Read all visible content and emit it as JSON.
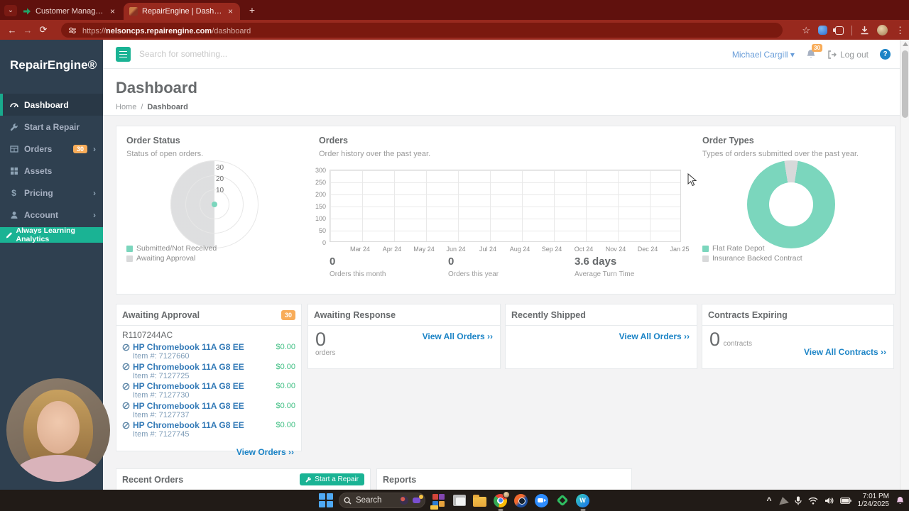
{
  "browser": {
    "tabs": [
      {
        "title": "Customer Manager | RepairEng"
      },
      {
        "title": "RepairEngine | Dashboard"
      }
    ],
    "url_scheme": "https://",
    "url_host": "nelsoncps.repairengine.com",
    "url_path": "/dashboard"
  },
  "glyphs": {
    "back": "←",
    "forward": "→",
    "refresh": "⟳",
    "star": "☆",
    "menu": "⋮",
    "new_tab": "+",
    "close": "×",
    "tab_search": "⌄",
    "chevron_right": "›",
    "caret_down": "▾",
    "help": "?",
    "tray_chevron": "^",
    "breadcrumb_sep": "/",
    "dollar": "$"
  },
  "sidebar": {
    "logo": "RepairEngine®",
    "items": [
      {
        "label": "Dashboard"
      },
      {
        "label": "Start a Repair"
      },
      {
        "label": "Orders",
        "badge": "30"
      },
      {
        "label": "Assets"
      },
      {
        "label": "Pricing"
      },
      {
        "label": "Account"
      }
    ],
    "analytics_button": "Always Learning Analytics"
  },
  "header": {
    "search_placeholder": "Search for something...",
    "user_name": "Michael Cargill",
    "notification_badge": "30",
    "logout_label": "Log out"
  },
  "page": {
    "title": "Dashboard",
    "breadcrumb_home": "Home",
    "breadcrumb_current": "Dashboard"
  },
  "chart_data": [
    {
      "type": "polar-area",
      "title": "Order Status",
      "subtitle": "Status of open orders.",
      "radial_ticks": [
        "30",
        "20",
        "10"
      ],
      "rlim": [
        0,
        30
      ],
      "series": [
        {
          "name": "Submitted/Not Received",
          "value": 2,
          "color": "#7bd6bd"
        },
        {
          "name": "Awaiting Approval",
          "value": 30,
          "color": "#d8d9da"
        }
      ],
      "legend_position": "bottom-left"
    },
    {
      "type": "line",
      "title": "Orders",
      "subtitle": "Order history over the past year.",
      "x": [
        "Mar 24",
        "Apr 24",
        "May 24",
        "Jun 24",
        "Jul 24",
        "Aug 24",
        "Sep 24",
        "Oct 24",
        "Nov 24",
        "Dec 24",
        "Jan 25"
      ],
      "yticks": [
        300,
        250,
        200,
        150,
        100,
        50,
        0
      ],
      "ylim": [
        0,
        300
      ],
      "grid": true,
      "series": [],
      "stats": [
        {
          "value": "0",
          "label": "Orders this month"
        },
        {
          "value": "0",
          "label": "Orders this year"
        },
        {
          "value": "3.6 days",
          "label": "Average Turn Time"
        }
      ]
    },
    {
      "type": "pie",
      "donut": true,
      "title": "Order Types",
      "subtitle": "Types of orders submitted over the past year.",
      "series": [
        {
          "name": "Flat Rate Depot",
          "value": 95,
          "color": "#7bd6bd"
        },
        {
          "name": "Insurance Backed Contract",
          "value": 5,
          "color": "#d8d9da"
        }
      ],
      "legend_position": "bottom-left"
    }
  ],
  "panels": {
    "awaiting_approval": {
      "title": "Awaiting Approval",
      "badge": "30",
      "group": "R1107244AC",
      "items": [
        {
          "name": "HP Chromebook 11A G8 EE",
          "item_no": "Item #: 7127660",
          "price": "$0.00"
        },
        {
          "name": "HP Chromebook 11A G8 EE",
          "item_no": "Item #: 7127725",
          "price": "$0.00"
        },
        {
          "name": "HP Chromebook 11A G8 EE",
          "item_no": "Item #: 7127730",
          "price": "$0.00"
        },
        {
          "name": "HP Chromebook 11A G8 EE",
          "item_no": "Item #: 7127737",
          "price": "$0.00"
        },
        {
          "name": "HP Chromebook 11A G8 EE",
          "item_no": "Item #: 7127745",
          "price": "$0.00"
        }
      ],
      "footer_link": "View Orders ››"
    },
    "awaiting_response": {
      "title": "Awaiting Response",
      "count": "0",
      "count_label": "orders",
      "link": "View All Orders ››"
    },
    "recently_shipped": {
      "title": "Recently Shipped",
      "link": "View All Orders ››"
    },
    "contracts_expiring": {
      "title": "Contracts Expiring",
      "count": "0",
      "count_label": "contracts",
      "link": "View All Contracts ››"
    },
    "recent_orders": {
      "title": "Recent Orders",
      "button": "Start a Repair"
    },
    "reports": {
      "title": "Reports"
    }
  },
  "taskbar": {
    "search_label": "Search",
    "clock_time": "7:01 PM",
    "clock_date": "1/24/2025"
  },
  "colors": {
    "accent_teal": "#1ab394",
    "chart_teal": "#7bd6bd",
    "chart_gray": "#d8d9da",
    "badge_orange": "#f8ac59",
    "link_blue": "#1c84c6",
    "money_green": "#3fbf83",
    "sidebar_bg": "#2f4050",
    "browser_red": "#98291e"
  }
}
